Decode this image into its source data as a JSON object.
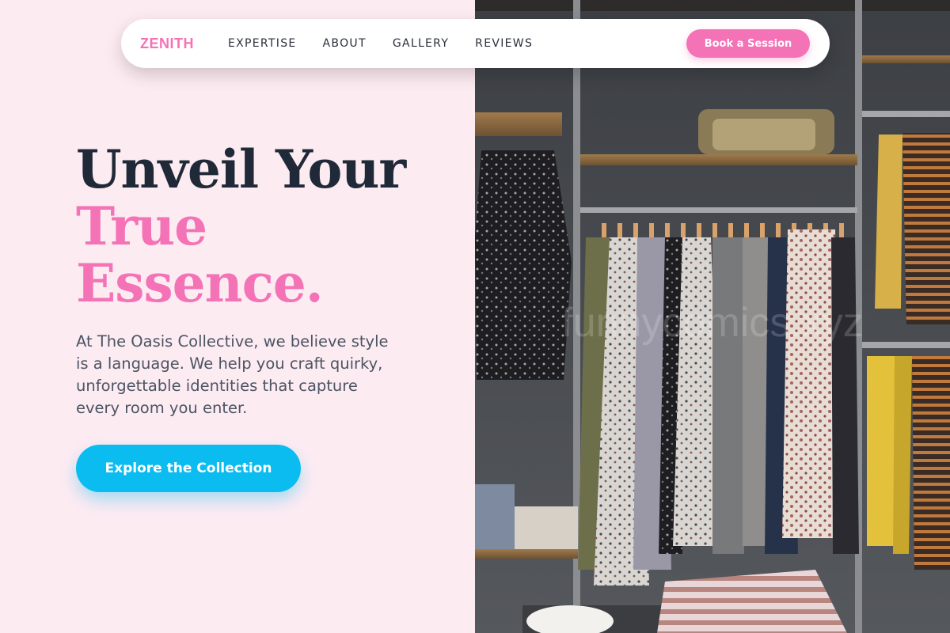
{
  "brand": {
    "name": "ZENITH"
  },
  "nav": {
    "links": [
      {
        "label": "EXPERTISE"
      },
      {
        "label": "ABOUT"
      },
      {
        "label": "GALLERY"
      },
      {
        "label": "REVIEWS"
      }
    ],
    "cta_label": "Book a Session"
  },
  "hero": {
    "title_line1": "Unveil Your",
    "title_line2": "True",
    "title_line3": "Essence.",
    "description": "At The Oasis Collective, we believe style is a language. We help you craft quirky, unforgettable identities that capture every room you enter.",
    "button_label": "Explore the Collection"
  },
  "image": {
    "watermark": "funnycomics.xyz"
  },
  "colors": {
    "accent_pink": "#f472b6",
    "accent_blue": "#0bbcf0",
    "background": "#fdebf2",
    "heading": "#1f2937"
  }
}
